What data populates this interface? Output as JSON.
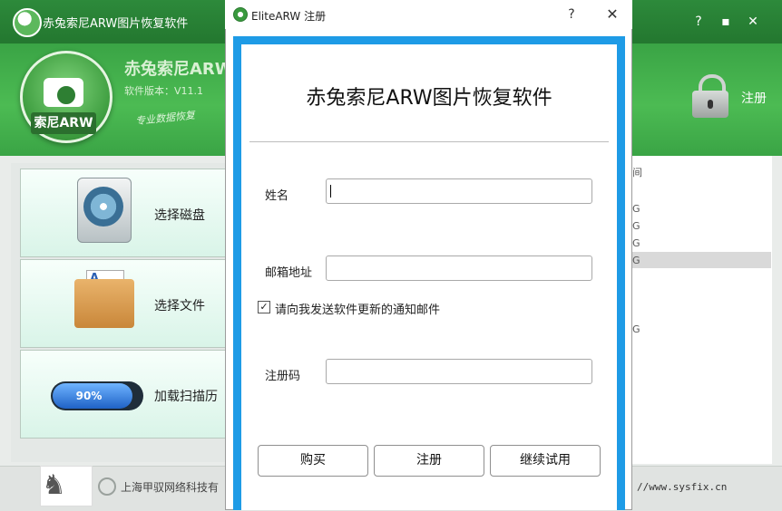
{
  "main_window": {
    "title": "赤兔索尼ARW图片恢复软件",
    "controls": {
      "help": "?",
      "minimize": "▪",
      "close": "✕"
    },
    "header": {
      "app_name": "赤兔索尼ARW",
      "version": "软件版本：V11.1",
      "slogan": "专业数据恢复",
      "logo_badge": "索尼ARW",
      "register_label": "注册"
    },
    "tiles": [
      {
        "label": "选择磁盘"
      },
      {
        "label": "选择文件"
      },
      {
        "label": "加载扫描历"
      }
    ],
    "progress": {
      "percent": 90,
      "text": "90%"
    },
    "list_fragments": [
      "间",
      "G",
      "G",
      "G",
      "G",
      "G"
    ],
    "footer": {
      "company": "上海甲驭网络科技有",
      "url": "//www.sysfix.cn"
    }
  },
  "dialog": {
    "title": "EliteARW 注册",
    "help": "?",
    "close": "✕",
    "heading": "赤兔索尼ARW图片恢复软件",
    "fields": {
      "name_label": "姓名",
      "name_value": "",
      "email_label": "邮箱地址",
      "email_value": "",
      "code_label": "注册码",
      "code_value": ""
    },
    "notify": {
      "checked": true,
      "check_mark": "✓",
      "label": "请向我发送软件更新的通知邮件"
    },
    "buttons": {
      "buy": "购买",
      "register": "注册",
      "trial": "继续试用"
    }
  },
  "colors": {
    "brand_green": "#3aa445",
    "dialog_frame": "#1e9be6"
  }
}
